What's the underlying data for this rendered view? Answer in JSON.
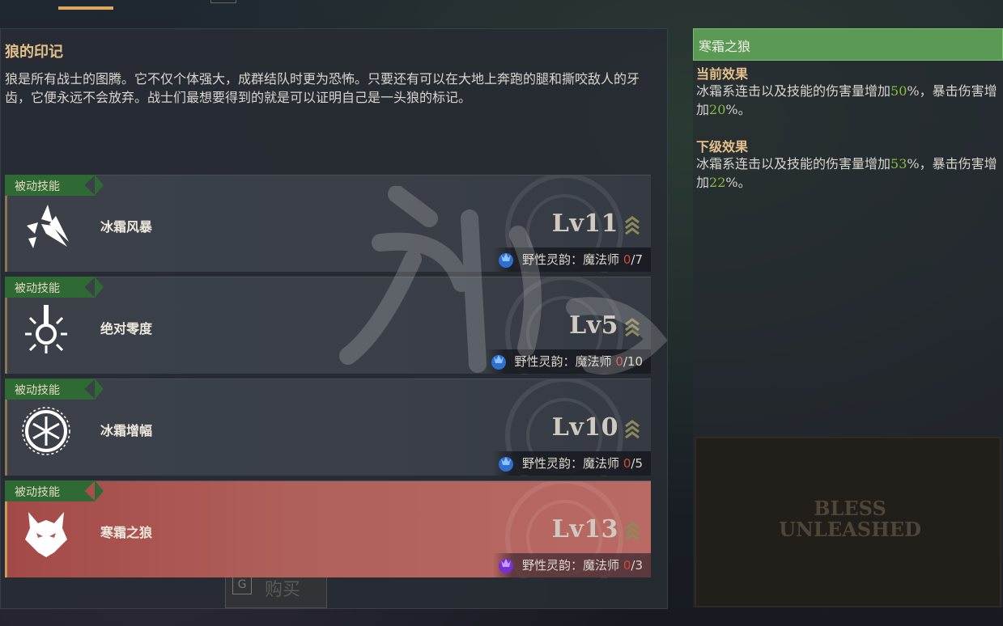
{
  "title": "狼的印记",
  "description": "狼是所有战士的图腾。它不仅个体强大，成群结队时更为恐怖。只要还有可以在大地上奔跑的腿和撕咬敌人的牙齿，它便永远不会放弃。战士们最想要得到的就是可以证明自己是一头狼的标记。",
  "skills": [
    {
      "tag": "被动技能",
      "name": "冰霜风暴",
      "level": "Lv11",
      "spirit": "野性灵韵：魔法师",
      "current": "0",
      "max": "/7",
      "icon": "shard-icon",
      "active": false
    },
    {
      "tag": "被动技能",
      "name": "绝对零度",
      "level": "Lv5",
      "spirit": "野性灵韵：魔法师",
      "current": "0",
      "max": "/10",
      "icon": "sun-blade-icon",
      "active": false
    },
    {
      "tag": "被动技能",
      "name": "冰霜增幅",
      "level": "Lv10",
      "spirit": "野性灵韵：魔法师",
      "current": "0",
      "max": "/5",
      "icon": "snowflake-ring-icon",
      "active": false
    },
    {
      "tag": "被动技能",
      "name": "寒霜之狼",
      "level": "Lv13",
      "spirit": "野性灵韵：魔法师",
      "current": "0",
      "max": "/3",
      "icon": "wolf-head-icon",
      "active": true
    }
  ],
  "side": {
    "header": "寒霜之狼",
    "current_title": "当前效果",
    "current_text": {
      "a": "冰霜系连击以及技能的伤害量增加",
      "v1": "50",
      "b": "%，暴击伤害增加",
      "v2": "20",
      "c": "%。"
    },
    "next_title": "下级效果",
    "next_text": {
      "a": "冰霜系连击以及技能的伤害量增加",
      "v1": "53",
      "b": "%，暴击伤害增加",
      "v2": "22",
      "c": "%。"
    }
  },
  "video": {
    "logo_line1": "BLESS",
    "logo_line2": "UNLEASHED"
  },
  "buy": {
    "g": "G",
    "label": "购买"
  },
  "colors": {
    "accent_green": "#5a9a55",
    "value_green": "#8bbd3f",
    "active_row": "#b0605a",
    "counter_red": "#d04a3a",
    "title_gold": "#e6c08a"
  }
}
